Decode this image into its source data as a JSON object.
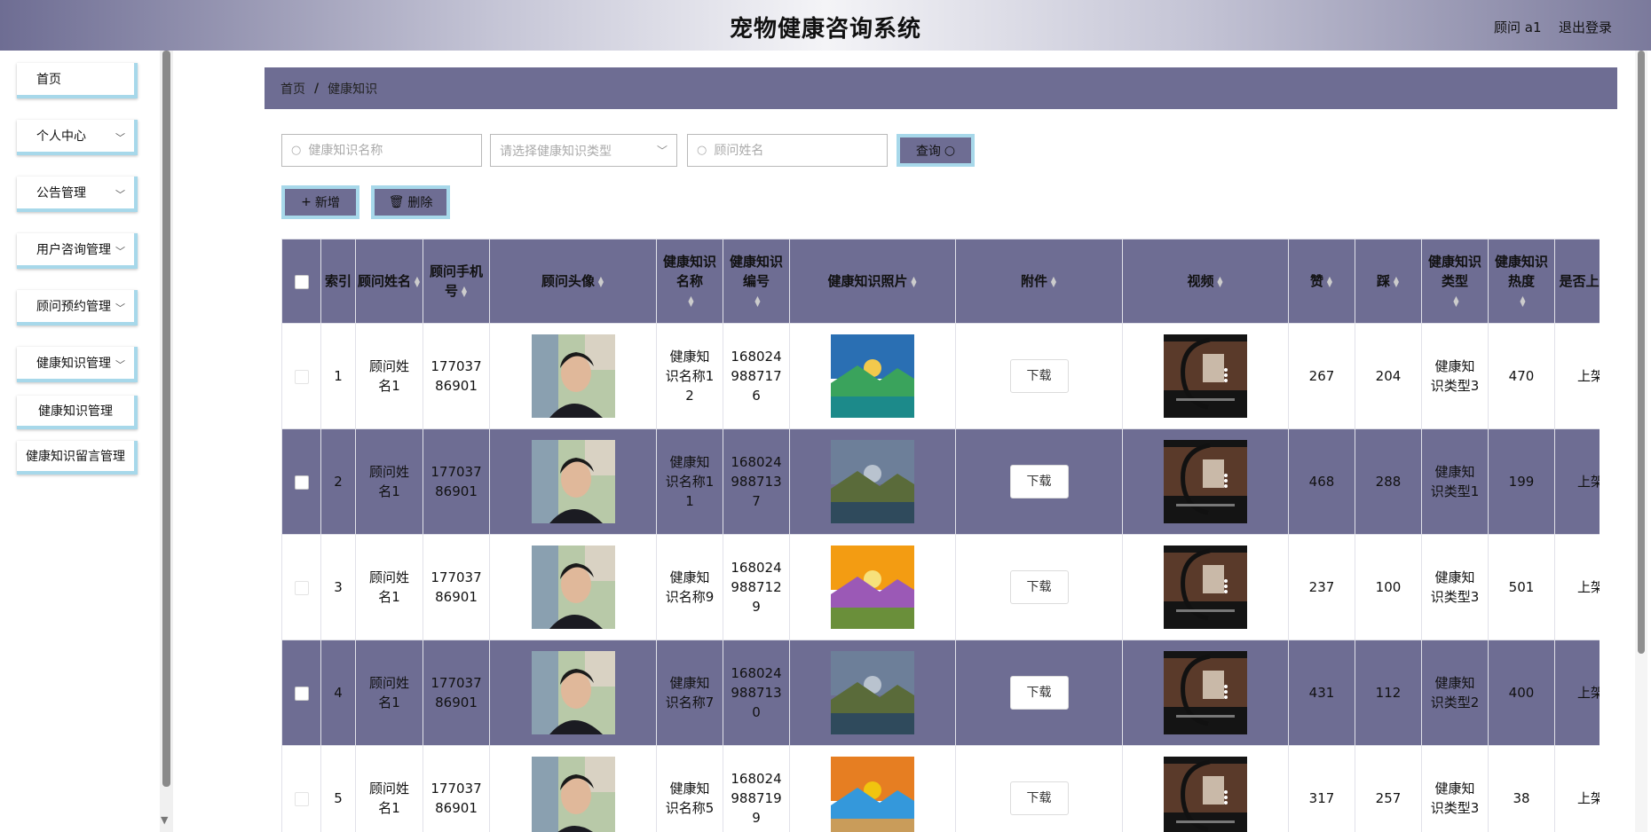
{
  "header": {
    "title": "宠物健康咨询系统",
    "user_label": "顾问 a1",
    "logout_label": "退出登录"
  },
  "sidebar": {
    "items": [
      {
        "label": "首页",
        "has_children": false
      },
      {
        "label": "个人中心",
        "has_children": true
      },
      {
        "label": "公告管理",
        "has_children": true
      },
      {
        "label": "用户咨询管理",
        "has_children": true
      },
      {
        "label": "顾问预约管理",
        "has_children": true
      },
      {
        "label": "健康知识管理",
        "has_children": true
      }
    ],
    "sub_items": [
      {
        "label": "健康知识管理"
      },
      {
        "label": "健康知识留言管理"
      }
    ]
  },
  "breadcrumb": {
    "home": "首页",
    "separator": "/",
    "current": "健康知识"
  },
  "search": {
    "name_placeholder": "健康知识名称",
    "type_placeholder": "请选择健康知识类型",
    "advisor_placeholder": "顾问姓名",
    "query_label": "查询"
  },
  "actions": {
    "add_label": "新增",
    "delete_label": "删除"
  },
  "table": {
    "headers": [
      "索引",
      "顾问姓名",
      "顾问手机号",
      "顾问头像",
      "健康知识名称",
      "健康知识编号",
      "健康知识照片",
      "附件",
      "视频",
      "赞",
      "踩",
      "健康知识类型",
      "健康知识热度",
      "是否上架"
    ],
    "download_label": "下载",
    "rows": [
      {
        "index": "1",
        "advisor_name": "顾问姓名1",
        "phone": "17703786901",
        "name": "健康知识名称12",
        "code": "1680249887176",
        "likes": "267",
        "dislikes": "204",
        "type": "健康知识类型3",
        "heat": "470",
        "status": "上架"
      },
      {
        "index": "2",
        "advisor_name": "顾问姓名1",
        "phone": "17703786901",
        "name": "健康知识名称11",
        "code": "1680249887137",
        "likes": "468",
        "dislikes": "288",
        "type": "健康知识类型1",
        "heat": "199",
        "status": "上架"
      },
      {
        "index": "3",
        "advisor_name": "顾问姓名1",
        "phone": "17703786901",
        "name": "健康知识名称9",
        "code": "1680249887129",
        "likes": "237",
        "dislikes": "100",
        "type": "健康知识类型3",
        "heat": "501",
        "status": "上架"
      },
      {
        "index": "4",
        "advisor_name": "顾问姓名1",
        "phone": "17703786901",
        "name": "健康知识名称7",
        "code": "1680249887130",
        "likes": "431",
        "dislikes": "112",
        "type": "健康知识类型2",
        "heat": "400",
        "status": "上架"
      },
      {
        "index": "5",
        "advisor_name": "顾问姓名1",
        "phone": "17703786901",
        "name": "健康知识名称5",
        "code": "1680249887199",
        "likes": "317",
        "dislikes": "257",
        "type": "健康知识类型3",
        "heat": "38",
        "status": "上架"
      }
    ]
  },
  "colors": {
    "accent": "#6e6d93",
    "border_accent": "#a7d8ea"
  }
}
